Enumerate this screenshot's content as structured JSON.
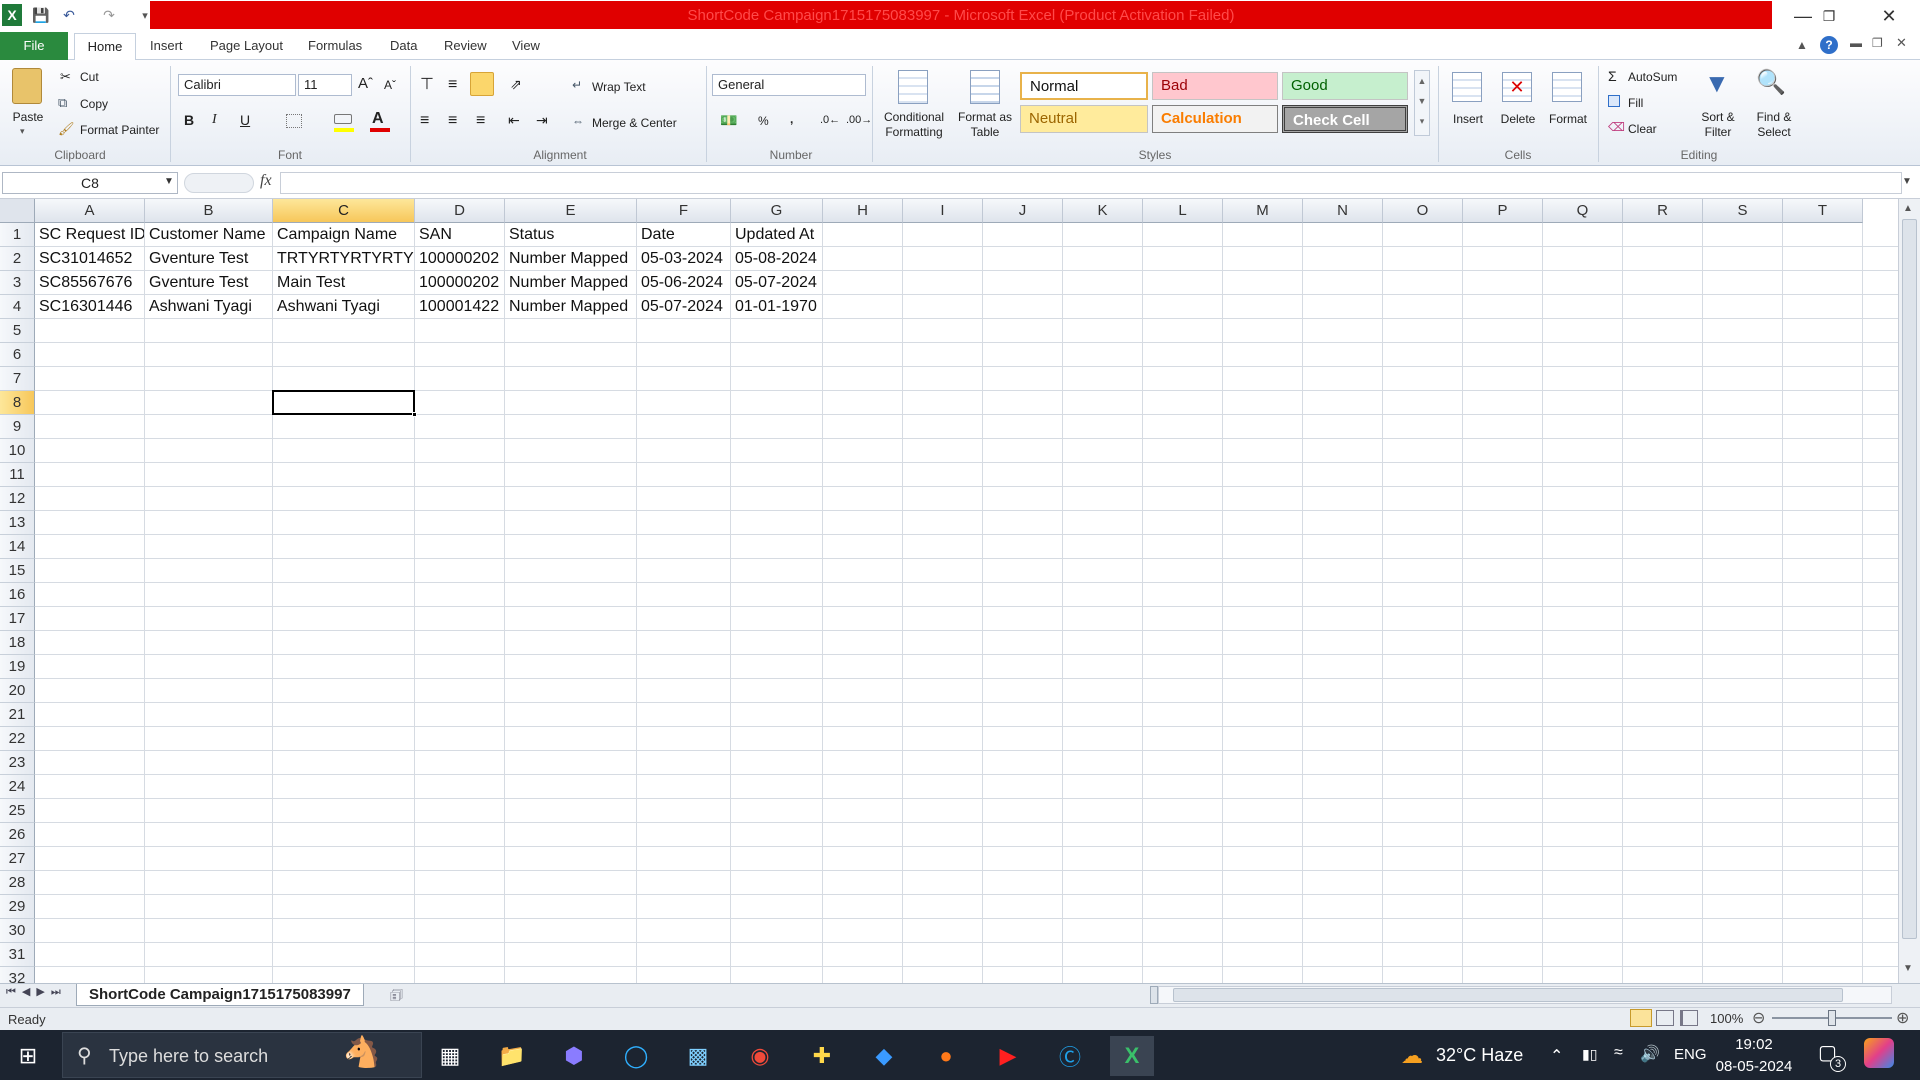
{
  "window": {
    "title": "ShortCode Campaign1715175083997  -  Microsoft Excel (Product Activation Failed)"
  },
  "tabs": [
    "File",
    "Home",
    "Insert",
    "Page Layout",
    "Formulas",
    "Data",
    "Review",
    "View"
  ],
  "ribbon": {
    "clipboard": {
      "paste": "Paste",
      "cut": "Cut",
      "copy": "Copy",
      "format_painter": "Format Painter",
      "label": "Clipboard"
    },
    "font": {
      "name": "Calibri",
      "size": "11",
      "label": "Font",
      "bold": "B",
      "italic": "I",
      "underline": "U"
    },
    "alignment": {
      "wrap_text": "Wrap Text",
      "merge_center": "Merge & Center",
      "label": "Alignment"
    },
    "number": {
      "format": "General",
      "label": "Number",
      "percent": "%",
      "comma": ","
    },
    "styles": {
      "conditional": "Conditional Formatting",
      "format_table": "Format as Table",
      "normal": "Normal",
      "bad": "Bad",
      "good": "Good",
      "neutral": "Neutral",
      "calculation": "Calculation",
      "check_cell": "Check Cell",
      "label": "Styles"
    },
    "cells": {
      "insert": "Insert",
      "delete": "Delete",
      "format": "Format",
      "label": "Cells"
    },
    "editing": {
      "autosum": "AutoSum",
      "fill": "Fill",
      "clear": "Clear",
      "sort_filter": "Sort & Filter",
      "find_select": "Find & Select",
      "label": "Editing"
    }
  },
  "formula_bar": {
    "name_box": "C8",
    "fx": "fx",
    "value": ""
  },
  "grid": {
    "columns": [
      "A",
      "B",
      "C",
      "D",
      "E",
      "F",
      "G",
      "H",
      "I",
      "J",
      "K",
      "L",
      "M",
      "N",
      "O",
      "P",
      "Q",
      "R",
      "S",
      "T"
    ],
    "selected_column": "C",
    "selected_row": 8,
    "rows_visible": 32,
    "data": [
      [
        "SC Request ID",
        "Customer Name",
        "Campaign Name",
        "SAN",
        "Status",
        "Date",
        "Updated At"
      ],
      [
        "SC31014652",
        "Gventure Test",
        "TRTYRTYRTYRTYR",
        "100000202",
        "Number Mapped",
        "05-03-2024",
        "05-08-2024"
      ],
      [
        "SC85567676",
        "Gventure Test",
        "Main Test",
        "100000202",
        "Number Mapped",
        "05-06-2024",
        "05-07-2024"
      ],
      [
        "SC16301446",
        "Ashwani Tyagi",
        "Ashwani Tyagi",
        "100001422",
        "Number Mapped",
        "05-07-2024",
        "01-01-1970"
      ]
    ]
  },
  "sheet_tab": "ShortCode Campaign1715175083997",
  "status": {
    "ready": "Ready",
    "zoom": "100%"
  },
  "taskbar": {
    "search_placeholder": "Type here to search",
    "weather": "32°C  Haze",
    "lang": "ENG",
    "time": "19:02",
    "date": "08-05-2024",
    "notif_count": "3"
  },
  "colors": {
    "excel_green": "#2a8a3e",
    "title_red": "#e00000",
    "selection_header": "#f7c75a"
  }
}
